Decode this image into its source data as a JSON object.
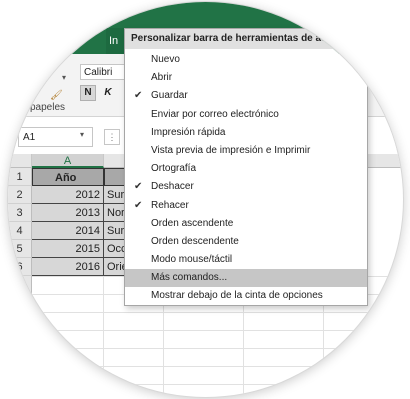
{
  "ribbon": {
    "tab_active_label": "In",
    "font_name": "Calibri",
    "bold_label": "N",
    "italic_label": "K",
    "clipboard_group_label": "papeles",
    "paste_dropdown_glyph": "▾",
    "format_painter_glyph": "🖌"
  },
  "formula_bar": {
    "name_box": "A1",
    "name_box_dropdown_glyph": "▾",
    "fx_glyph": "⋮"
  },
  "sheet": {
    "columns": [
      "A",
      ""
    ],
    "rows": [
      "1",
      "2",
      "3",
      "4",
      "5",
      "6"
    ],
    "header_row": [
      "Año",
      ""
    ],
    "data_rows": [
      [
        "2012",
        "Sur"
      ],
      [
        "2013",
        "Nor"
      ],
      [
        "2014",
        "Sur"
      ],
      [
        "2015",
        "Occ"
      ],
      [
        "2016",
        "Orie"
      ]
    ]
  },
  "menu": {
    "title": "Personalizar barra de herramientas de acceso r",
    "check_glyph": "✔",
    "items": [
      {
        "label": "Nuevo",
        "checked": false
      },
      {
        "label": "Abrir",
        "checked": false
      },
      {
        "label": "Guardar",
        "checked": true
      },
      {
        "label": "Enviar por correo electrónico",
        "checked": false
      },
      {
        "label": "Impresión rápida",
        "checked": false
      },
      {
        "label": "Vista previa de impresión e Imprimir",
        "checked": false
      },
      {
        "label": "Ortografía",
        "checked": false
      },
      {
        "label": "Deshacer",
        "checked": true
      },
      {
        "label": "Rehacer",
        "checked": true
      },
      {
        "label": "Orden ascendente",
        "checked": false
      },
      {
        "label": "Orden descendente",
        "checked": false
      },
      {
        "label": "Modo mouse/táctil",
        "checked": false
      },
      {
        "label": "Más comandos...",
        "checked": false,
        "highlighted": true
      },
      {
        "label": "Mostrar debajo de la cinta de opciones",
        "checked": false
      }
    ]
  },
  "colors": {
    "ribbon_green": "#217346",
    "cell_header_fill": "#a8a8a8",
    "cell_data_fill": "#d7d7d7",
    "menu_highlight": "#c6c6c6"
  }
}
